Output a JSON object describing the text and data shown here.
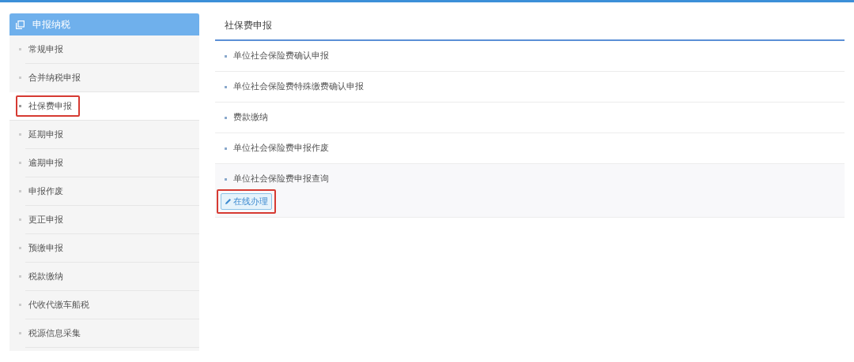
{
  "sidebar": {
    "title": "申报纳税",
    "items": [
      {
        "label": "常规申报",
        "selected": false,
        "highlighted": false
      },
      {
        "label": "合并纳税申报",
        "selected": false,
        "highlighted": false
      },
      {
        "label": "社保费申报",
        "selected": true,
        "highlighted": true
      },
      {
        "label": "延期申报",
        "selected": false,
        "highlighted": false
      },
      {
        "label": "逾期申报",
        "selected": false,
        "highlighted": false
      },
      {
        "label": "申报作废",
        "selected": false,
        "highlighted": false
      },
      {
        "label": "更正申报",
        "selected": false,
        "highlighted": false
      },
      {
        "label": "预缴申报",
        "selected": false,
        "highlighted": false
      },
      {
        "label": "税款缴纳",
        "selected": false,
        "highlighted": false
      },
      {
        "label": "代收代缴车船税",
        "selected": false,
        "highlighted": false
      },
      {
        "label": "税源信息采集",
        "selected": false,
        "highlighted": false
      }
    ]
  },
  "panel": {
    "title": "社保费申报",
    "items": [
      {
        "label": "单位社会保险费确认申报",
        "expanded": false
      },
      {
        "label": "单位社会保险费特殊缴费确认申报",
        "expanded": false
      },
      {
        "label": "费款缴纳",
        "expanded": false
      },
      {
        "label": "单位社会保险费申报作废",
        "expanded": false
      },
      {
        "label": "单位社会保险费申报查询",
        "expanded": true,
        "action": "在线办理",
        "action_highlighted": true
      }
    ]
  }
}
